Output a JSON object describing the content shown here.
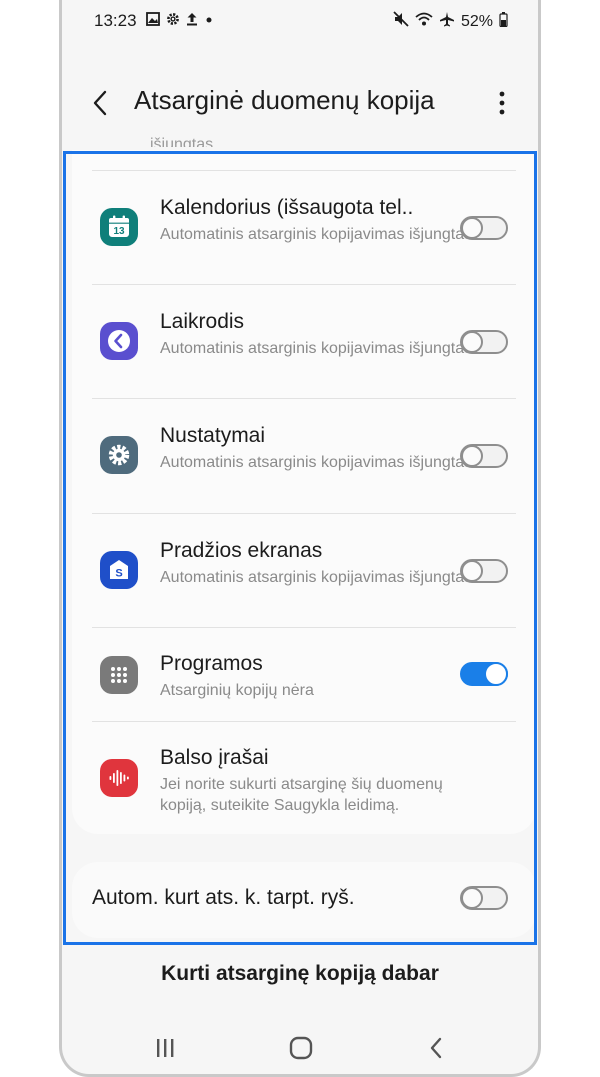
{
  "status_bar": {
    "time": "13:23",
    "battery": "52%",
    "left_icons": [
      "image-icon",
      "gear-icon",
      "upload-icon",
      "dot-icon"
    ],
    "right_icons": [
      "mute-icon",
      "wifi-icon",
      "airplane-icon",
      "battery-icon"
    ]
  },
  "header": {
    "title": "Atsarginė duomenų kopija"
  },
  "peek_text": "išjungtas",
  "items": [
    {
      "icon": "calendar-icon",
      "icon_text": "13",
      "title": "Kalendorius (išsaugota tel..",
      "subtitle": "Automatinis atsarginis kopijavimas išjungtas",
      "toggle": "off"
    },
    {
      "icon": "clock-icon",
      "title": "Laikrodis",
      "subtitle": "Automatinis atsarginis kopijavimas išjungtas",
      "toggle": "off"
    },
    {
      "icon": "settings-icon",
      "title": "Nustatymai",
      "subtitle": "Automatinis atsarginis kopijavimas išjungtas",
      "toggle": "off"
    },
    {
      "icon": "home-screen-icon",
      "title": "Pradžios ekranas",
      "subtitle": "Automatinis atsarginis kopijavimas išjungtas",
      "toggle": "off"
    },
    {
      "icon": "apps-icon",
      "title": "Programos",
      "subtitle": "Atsarginių kopijų nėra",
      "toggle": "on"
    },
    {
      "icon": "voice-recorder-icon",
      "title": "Balso įrašai",
      "subtitle": "Jei norite sukurti atsarginę šių duomenų kopiją, suteikite Saugykla leidimą."
    }
  ],
  "roaming": {
    "label": "Autom. kurt ats. k. tarpt. ryš.",
    "toggle": "off"
  },
  "backup_now_label": "Kurti atsarginę kopiją dabar",
  "colors": {
    "accent": "#1a7fe8",
    "highlight_frame": "#1a73e8",
    "calendar": "#0f7f7a",
    "clock": "#5a4fcf",
    "settings": "#4f6b7d",
    "home_screen": "#1f4fc9",
    "apps": "#7a7a7a",
    "voice_recorder": "#e0353d"
  }
}
